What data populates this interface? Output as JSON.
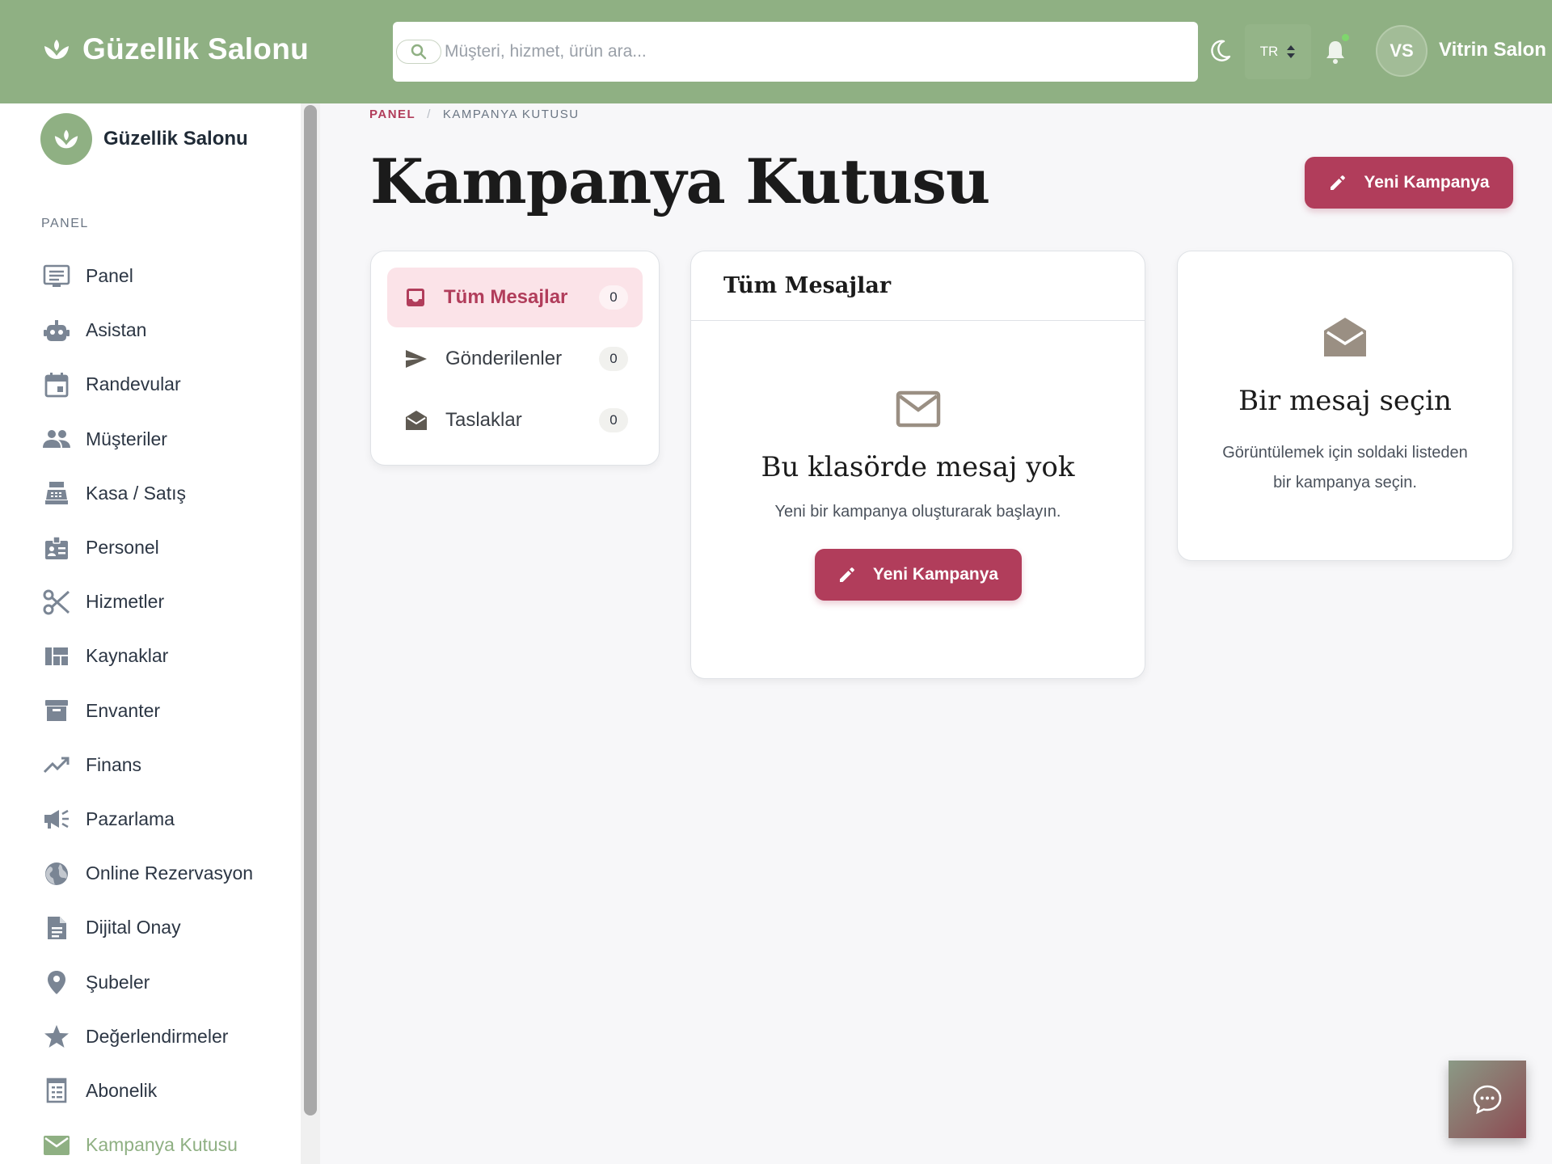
{
  "header": {
    "brand": "Güzellik Salonu",
    "search_placeholder": "Müşteri, hizmet, ürün ara...",
    "language": "TR",
    "user_initials": "VS",
    "user_name": "Vitrin Salon"
  },
  "sidebar": {
    "brand": "Güzellik Salonu",
    "section": "PANEL",
    "items": [
      {
        "label": "Panel",
        "icon": "dashboard-icon"
      },
      {
        "label": "Asistan",
        "icon": "robot-icon"
      },
      {
        "label": "Randevular",
        "icon": "calendar-icon"
      },
      {
        "label": "Müşteriler",
        "icon": "people-icon"
      },
      {
        "label": "Kasa / Satış",
        "icon": "cash-register-icon"
      },
      {
        "label": "Personel",
        "icon": "badge-icon"
      },
      {
        "label": "Hizmetler",
        "icon": "scissors-icon"
      },
      {
        "label": "Kaynaklar",
        "icon": "grid-icon"
      },
      {
        "label": "Envanter",
        "icon": "archive-icon"
      },
      {
        "label": "Finans",
        "icon": "trending-up-icon"
      },
      {
        "label": "Pazarlama",
        "icon": "megaphone-icon"
      },
      {
        "label": "Online Rezervasyon",
        "icon": "globe-icon"
      },
      {
        "label": "Dijital Onay",
        "icon": "document-icon"
      },
      {
        "label": "Şubeler",
        "icon": "location-pin-icon"
      },
      {
        "label": "Değerlendirmeler",
        "icon": "star-icon"
      },
      {
        "label": "Abonelik",
        "icon": "receipt-icon"
      },
      {
        "label": "Kampanya Kutusu",
        "icon": "mail-icon",
        "active": true
      }
    ]
  },
  "breadcrumb": {
    "home": "PANEL",
    "separator": "/",
    "current": "KAMPANYA KUTUSU"
  },
  "page": {
    "title": "Kampanya Kutusu",
    "new_button": "Yeni Kampanya"
  },
  "folders": [
    {
      "label": "Tüm Mesajlar",
      "count": "0",
      "active": true
    },
    {
      "label": "Gönderilenler",
      "count": "0"
    },
    {
      "label": "Taslaklar",
      "count": "0"
    }
  ],
  "list": {
    "title": "Tüm Mesajlar",
    "empty_title": "Bu klasörde mesaj yok",
    "empty_desc": "Yeni bir kampanya oluşturarak başlayın.",
    "empty_button": "Yeni Kampanya"
  },
  "detail": {
    "title": "Bir mesaj seçin",
    "desc": "Görüntülemek için soldaki listeden bir kampanya seçin."
  },
  "colors": {
    "header_green": "#8fb083",
    "accent": "#b13d5b",
    "active_sidebar": "#8fb083"
  }
}
